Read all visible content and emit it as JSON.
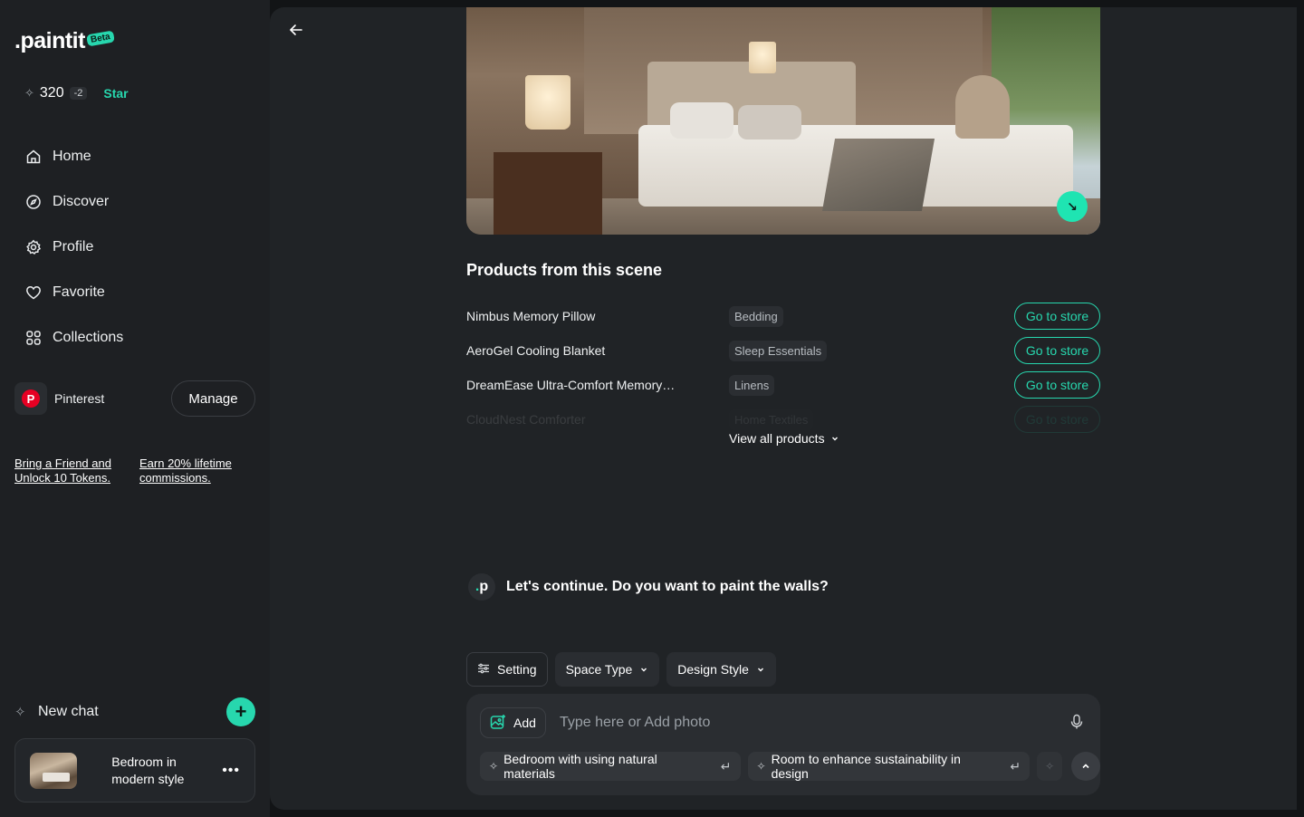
{
  "brand": {
    "name": ".paintit",
    "badge": "Beta"
  },
  "tokens": {
    "count": "320",
    "delta": "-2",
    "star_label": "Star"
  },
  "nav": {
    "items": [
      {
        "label": "Home",
        "icon": "home-icon"
      },
      {
        "label": "Discover",
        "icon": "compass-icon"
      },
      {
        "label": "Profile",
        "icon": "gear-icon"
      },
      {
        "label": "Favorite",
        "icon": "heart-icon"
      },
      {
        "label": "Collections",
        "icon": "grid-icon"
      }
    ]
  },
  "pinterest": {
    "label": "Pinterest",
    "manage_label": "Manage"
  },
  "referral": {
    "link1": "Bring a Friend and Unlock 10 Tokens.",
    "link2": "Earn 20% lifetime commissions."
  },
  "new_chat": {
    "label": "New chat"
  },
  "chat_history": [
    {
      "title": "Bedroom in modern style",
      "more": "•••"
    }
  ],
  "main": {
    "products_title": "Products from this scene",
    "products": [
      {
        "name": "Nimbus Memory Pillow",
        "tag": "Bedding",
        "action": "Go to store"
      },
      {
        "name": "AeroGel Cooling Blanket",
        "tag": "Sleep Essentials",
        "action": "Go to store"
      },
      {
        "name": "DreamEase Ultra-Comfort Memory…",
        "tag": "Linens",
        "action": "Go to store"
      },
      {
        "name": "CloudNest Comforter",
        "tag": "Home Textiles",
        "action": "Go to store"
      }
    ],
    "view_all_label": "View all products",
    "bot_message": "Let's continue. Do you want to paint the walls?",
    "options": {
      "setting": "Setting",
      "space_type": "Space Type",
      "design_style": "Design Style"
    },
    "composer": {
      "add_label": "Add",
      "placeholder": "Type here or Add photo",
      "suggestions": [
        "Bedroom with using natural materials",
        "Room to enhance sustainability in design"
      ]
    }
  },
  "colors": {
    "accent": "#27d7ae",
    "sidebar_bg": "#1e2023",
    "main_bg": "#202326",
    "page_bg": "#121416"
  }
}
